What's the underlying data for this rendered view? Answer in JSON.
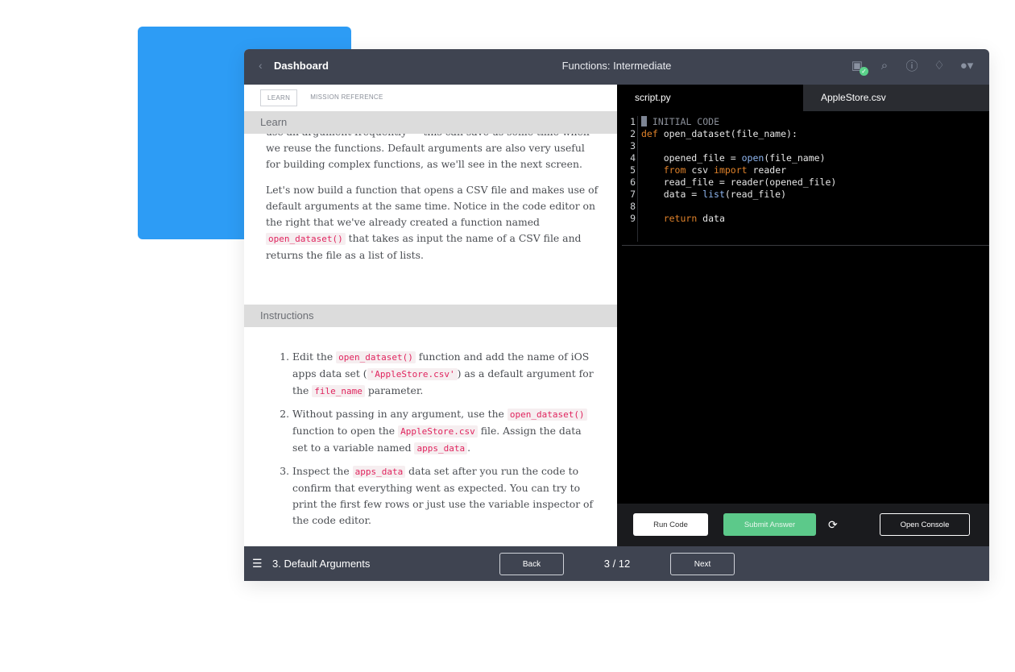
{
  "topbar": {
    "back_label": "Dashboard",
    "title": "Functions: Intermediate",
    "icons": [
      "status-check-icon",
      "search-icon",
      "help-icon",
      "bell-icon",
      "user-avatar-icon"
    ]
  },
  "left_tabs": {
    "learn": "LEARN",
    "mission_reference": "MISSION REFERENCE"
  },
  "learn": {
    "heading": "Learn",
    "partial_line": "use an argument frequently — this can save us some time when",
    "p1_rest": "we reuse the functions. Default arguments are also very useful for building complex functions, as we'll see in the next screen.",
    "p2_a": "Let's now build a function that opens a CSV file and makes use of default arguments at the same time. Notice in the code editor on the right that we've already created a function named",
    "p2_code": "open_dataset()",
    "p2_b": "that takes as input the name of a CSV file and returns the file as a list of lists."
  },
  "instructions": {
    "heading": "Instructions",
    "i1": {
      "a": "Edit the",
      "c1": "open_dataset()",
      "b": "function and add the name of iOS apps data set (",
      "c2": "'AppleStore.csv'",
      "d": ") as a default argument for the",
      "c3": "file_name",
      "e": "parameter."
    },
    "i2": {
      "a": "Without passing in any argument, use the",
      "c1": "open_dataset()",
      "b": "function to open the",
      "c2": "AppleStore.csv",
      "d": "file. Assign the data set to a variable named",
      "c3": "apps_data",
      "e": "."
    },
    "i3": {
      "a": "Inspect the",
      "c1": "apps_data",
      "b": "data set after you run the code to confirm that everything went as expected. You can try to print the first few rows or just use the variable inspector of the code editor."
    }
  },
  "editor": {
    "tabs": [
      "script.py",
      "AppleStore.csv"
    ],
    "line_numbers": [
      "1",
      "2",
      "3",
      "4",
      "5",
      "6",
      "7",
      "8",
      "9"
    ]
  },
  "runbar": {
    "run": "Run Code",
    "submit": "Submit Answer",
    "console": "Open Console"
  },
  "footer": {
    "lesson": "3. Default Arguments",
    "back": "Back",
    "page": "3 / 12",
    "next": "Next"
  },
  "colors": {
    "accent_blue": "#2d9cf5",
    "topbar": "#3f4451",
    "submit_green": "#5cc98a",
    "code_red": "#e0245e"
  }
}
